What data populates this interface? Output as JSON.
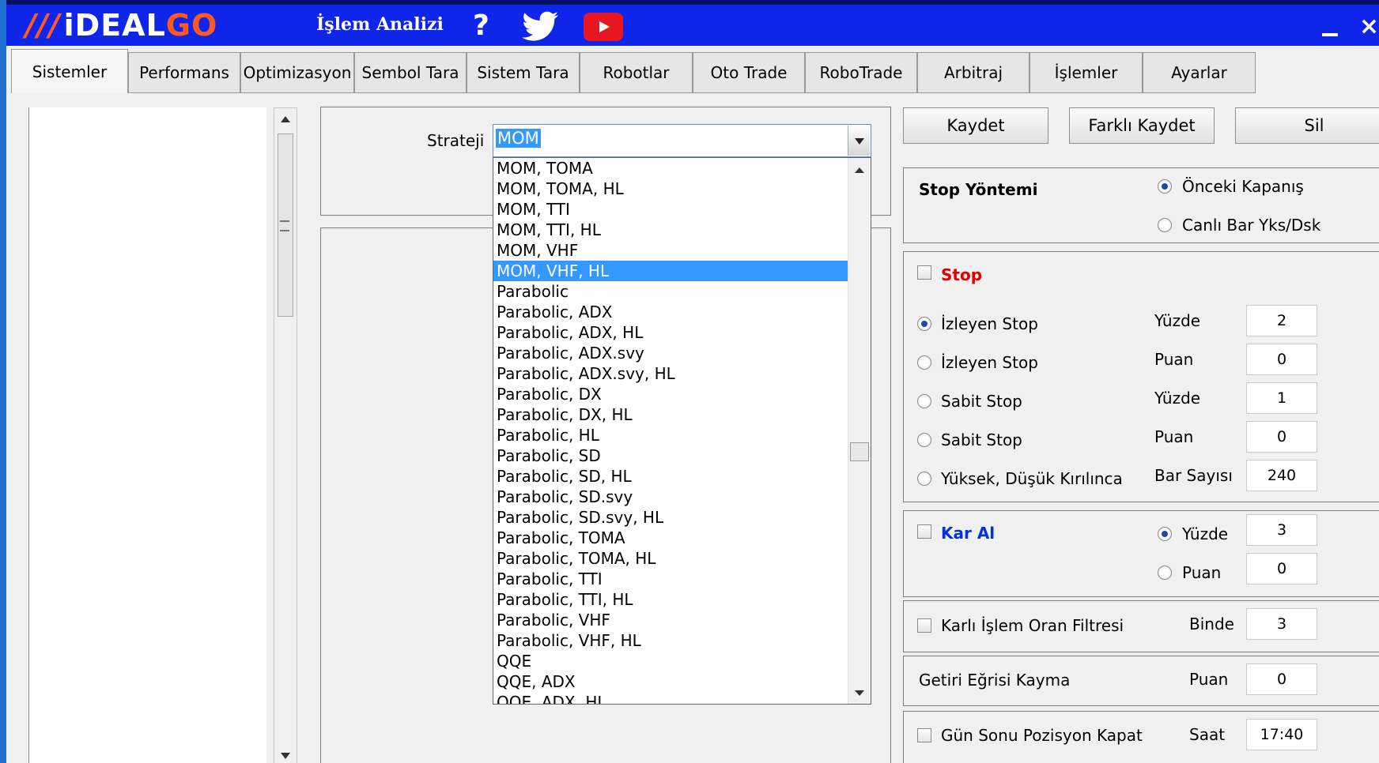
{
  "header": {
    "logo_prefix": "iDEAL",
    "logo_suffix": "GO",
    "app_title": "İşlem Analizi",
    "help": "?"
  },
  "tabs": [
    "Sistemler",
    "Performans",
    "Optimizasyon",
    "Sembol Tara",
    "Sistem Tara",
    "Robotlar",
    "Oto Trade",
    "RoboTrade",
    "Arbitraj",
    "İşlemler",
    "Ayarlar"
  ],
  "active_tab": "Sistemler",
  "strategy": {
    "label": "Strateji",
    "value": "MOM",
    "options": [
      "MOM, TOMA",
      "MOM, TOMA, HL",
      "MOM, TTI",
      "MOM, TTI, HL",
      "MOM, VHF",
      "MOM, VHF, HL",
      "Parabolic",
      "Parabolic, ADX",
      "Parabolic, ADX, HL",
      "Parabolic, ADX.svy",
      "Parabolic, ADX.svy, HL",
      "Parabolic, DX",
      "Parabolic, DX, HL",
      "Parabolic, HL",
      "Parabolic, SD",
      "Parabolic, SD, HL",
      "Parabolic, SD.svy",
      "Parabolic, SD.svy, HL",
      "Parabolic, TOMA",
      "Parabolic, TOMA, HL",
      "Parabolic, TTI",
      "Parabolic, TTI, HL",
      "Parabolic, VHF",
      "Parabolic, VHF, HL",
      "QQE",
      "QQE, ADX",
      "QQE, ADX, HL"
    ],
    "highlighted": "MOM, VHF, HL"
  },
  "buttons": {
    "save": "Kaydet",
    "save_as": "Farklı Kaydet",
    "delete": "Sil"
  },
  "stop_method": {
    "title": "Stop Yöntemi",
    "opt1": "Önceki Kapanış",
    "opt2": "Canlı Bar Yks/Dsk",
    "selected": "Önceki Kapanış"
  },
  "stop": {
    "title": "Stop",
    "title_color": "#e00000",
    "rows": [
      {
        "label": "İzleyen Stop",
        "unit": "Yüzde",
        "value": "2"
      },
      {
        "label": "İzleyen Stop",
        "unit": "Puan",
        "value": "0"
      },
      {
        "label": "Sabit Stop",
        "unit": "Yüzde",
        "value": "1"
      },
      {
        "label": "Sabit Stop",
        "unit": "Puan",
        "value": "0"
      },
      {
        "label": "Yüksek, Düşük Kırılınca",
        "unit": "Bar Sayısı",
        "value": "240"
      }
    ]
  },
  "take_profit": {
    "title": "Kar Al",
    "title_color": "#0033dd",
    "opt1": "Yüzde",
    "val1": "3",
    "opt2": "Puan",
    "val2": "0"
  },
  "profit_filter": {
    "label": "Karlı İşlem Oran Filtresi",
    "unit": "Binde",
    "value": "3"
  },
  "curve_slip": {
    "label": "Getiri Eğrisi Kayma",
    "unit": "Puan",
    "value": "0"
  },
  "eod_close": {
    "label": "Gün Sonu Pozisyon Kapat",
    "unit": "Saat",
    "value": "17:40"
  }
}
